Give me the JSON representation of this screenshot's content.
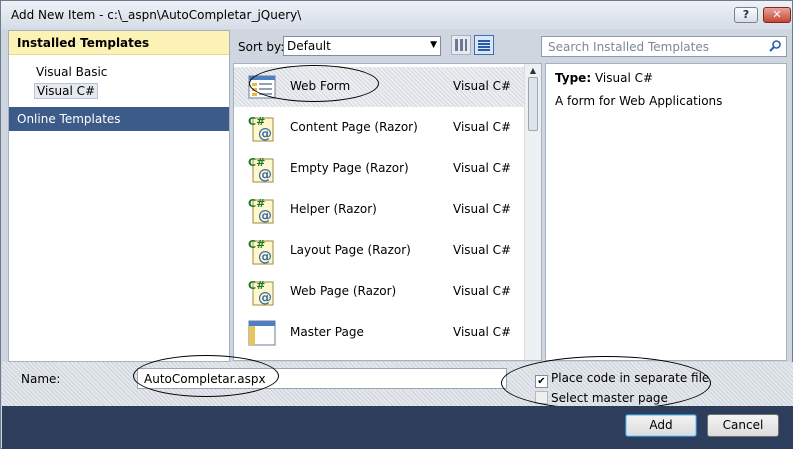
{
  "window": {
    "title": "Add New Item - c:\\_aspn\\AutoCompletar_jQuery\\",
    "help_glyph": "?",
    "close_glyph": "✕"
  },
  "left_pane": {
    "installed_header": "Installed Templates",
    "tree": [
      {
        "label": "Visual Basic"
      },
      {
        "label": "Visual C#",
        "selected": true
      }
    ],
    "online_header": "Online Templates"
  },
  "toolbar": {
    "sort_label": "Sort by:",
    "sort_value": "Default",
    "search_placeholder": "Search Installed Templates"
  },
  "templates": [
    {
      "name": "Web Form",
      "type": "Visual C#",
      "icon": "web-form-icon",
      "selected": true
    },
    {
      "name": "Content Page (Razor)",
      "type": "Visual C#",
      "icon": "razor-csharp-icon"
    },
    {
      "name": "Empty Page (Razor)",
      "type": "Visual C#",
      "icon": "razor-csharp-icon"
    },
    {
      "name": "Helper (Razor)",
      "type": "Visual C#",
      "icon": "razor-csharp-icon"
    },
    {
      "name": "Layout Page (Razor)",
      "type": "Visual C#",
      "icon": "razor-csharp-icon"
    },
    {
      "name": "Web Page (Razor)",
      "type": "Visual C#",
      "icon": "razor-csharp-icon"
    },
    {
      "name": "Master Page",
      "type": "Visual C#",
      "icon": "master-page-icon"
    }
  ],
  "details": {
    "type_label": "Type:",
    "type_value": "Visual C#",
    "description": "A form for Web Applications"
  },
  "name_field": {
    "label": "Name:",
    "value": "AutoCompletar.aspx"
  },
  "options": {
    "place_code_label": "Place code in separate file",
    "place_code_checked": true,
    "select_master_label": "Select master page",
    "select_master_checked": false
  },
  "buttons": {
    "add": "Add",
    "cancel": "Cancel"
  },
  "colors": {
    "header_yellow": "#fdf2b6",
    "online_blue": "#3d5b89",
    "footer_navy": "#2c3e5b"
  }
}
